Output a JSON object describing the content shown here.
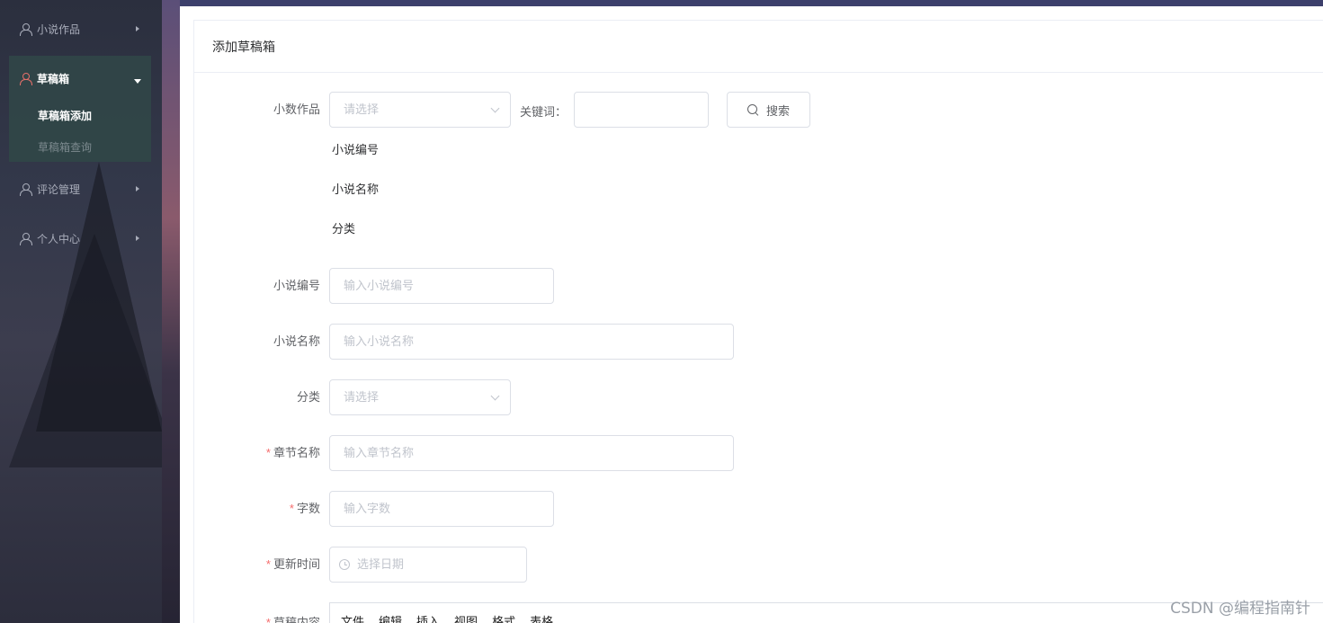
{
  "sidebar": {
    "items": [
      {
        "label": "小说作品"
      },
      {
        "label": "草稿箱",
        "expanded": true,
        "children": [
          {
            "label": "草稿箱添加",
            "active": true
          },
          {
            "label": "草稿箱查询"
          }
        ]
      },
      {
        "label": "评论管理"
      },
      {
        "label": "个人中心"
      }
    ]
  },
  "page": {
    "title": "添加草稿箱"
  },
  "search_row": {
    "novel_label": "小数作品",
    "novel_placeholder": "请选择",
    "keyword_label": "关键词：",
    "keyword_value": "",
    "search_button": "搜索"
  },
  "novel_info": {
    "fields": [
      "小说编号",
      "小说名称",
      "分类"
    ]
  },
  "form": {
    "novel_no": {
      "label": "小说编号",
      "placeholder": "输入小说编号"
    },
    "novel_name": {
      "label": "小说名称",
      "placeholder": "输入小说名称"
    },
    "category": {
      "label": "分类",
      "placeholder": "请选择"
    },
    "chapter_name": {
      "label": "章节名称",
      "placeholder": "输入章节名称",
      "required": true
    },
    "word_count": {
      "label": "字数",
      "placeholder": "输入字数",
      "required": true
    },
    "update_time": {
      "label": "更新时间",
      "placeholder": "选择日期",
      "required": true
    },
    "content": {
      "label": "草稿内容",
      "required": true
    }
  },
  "editor": {
    "menu": [
      "文件",
      "编辑",
      "插入",
      "视图",
      "格式",
      "表格"
    ]
  },
  "watermark": "CSDN @编程指南针",
  "colors": {
    "required": "#f56c6c",
    "active_icon": "#e5706a",
    "border": "#dcdfe6"
  }
}
